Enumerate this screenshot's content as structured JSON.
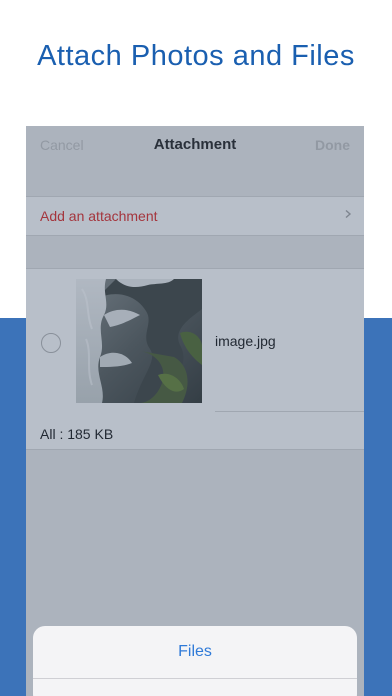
{
  "headline": "Attach Photos and Files",
  "navbar": {
    "cancel_label": "Cancel",
    "title": "Attachment",
    "done_label": "Done"
  },
  "attach_row": {
    "label": "Add an attachment",
    "icon": "chevron-right-icon"
  },
  "files": [
    {
      "name": "image.jpg",
      "selected": false,
      "thumbnail": "waterfall-photo"
    }
  ],
  "total_label": "All : 185 KB",
  "action_sheet": {
    "items": [
      "Files"
    ]
  },
  "colors": {
    "headline": "#1a5fb0",
    "band": "#3c73b9",
    "destructive": "#e2322f",
    "action": "#2f7ad8"
  }
}
